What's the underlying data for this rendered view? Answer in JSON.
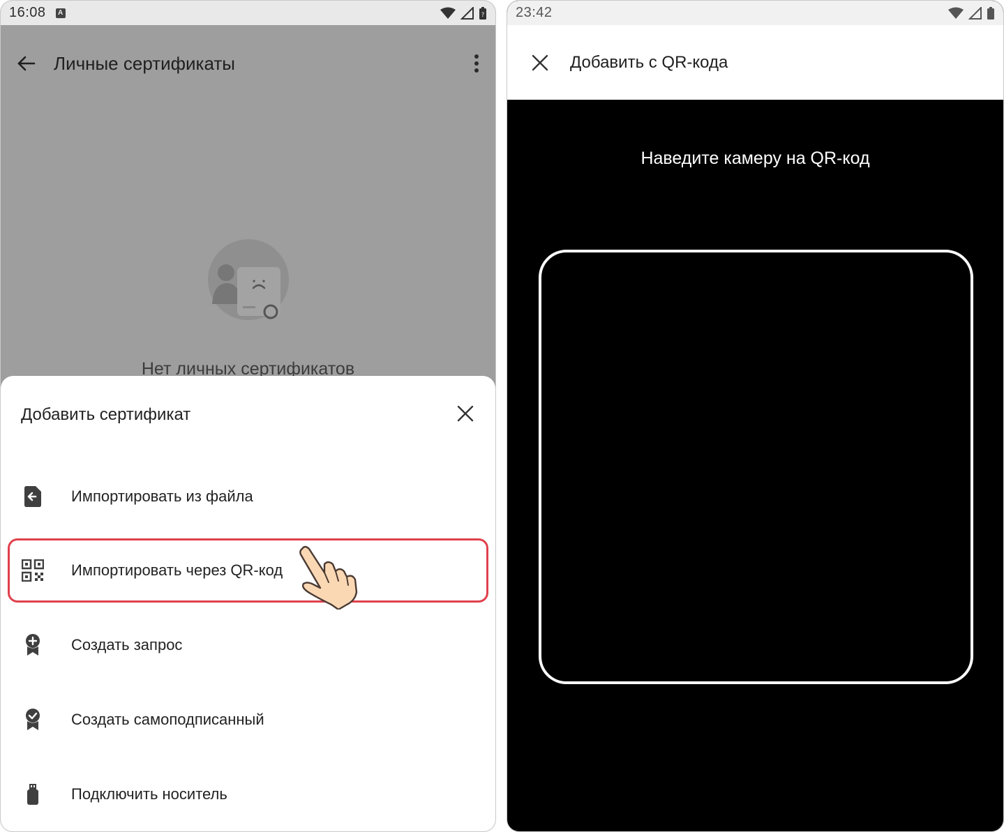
{
  "left": {
    "status": {
      "time": "16:08",
      "badge": "A"
    },
    "app_bar": {
      "title": "Личные сертификаты"
    },
    "empty_state": {
      "text": "Нет личных сертификатов"
    },
    "sheet": {
      "title": "Добавить сертификат",
      "items": [
        {
          "label": "Импортировать из файла",
          "icon": "file-import-icon"
        },
        {
          "label": "Импортировать через QR-код",
          "icon": "qr-code-icon",
          "highlighted": true
        },
        {
          "label": "Создать запрос",
          "icon": "certificate-add-icon"
        },
        {
          "label": "Создать самоподписанный",
          "icon": "certificate-check-icon"
        },
        {
          "label": "Подключить носитель",
          "icon": "usb-token-icon"
        }
      ]
    }
  },
  "right": {
    "status": {
      "time": "23:42"
    },
    "app_bar": {
      "title": "Добавить с QR-кода"
    },
    "scanner": {
      "hint": "Наведите камеру на QR-код"
    }
  },
  "colors": {
    "highlight": "#e0404d",
    "scrim": "#9e9e9e",
    "scanner_bg": "#000000"
  }
}
